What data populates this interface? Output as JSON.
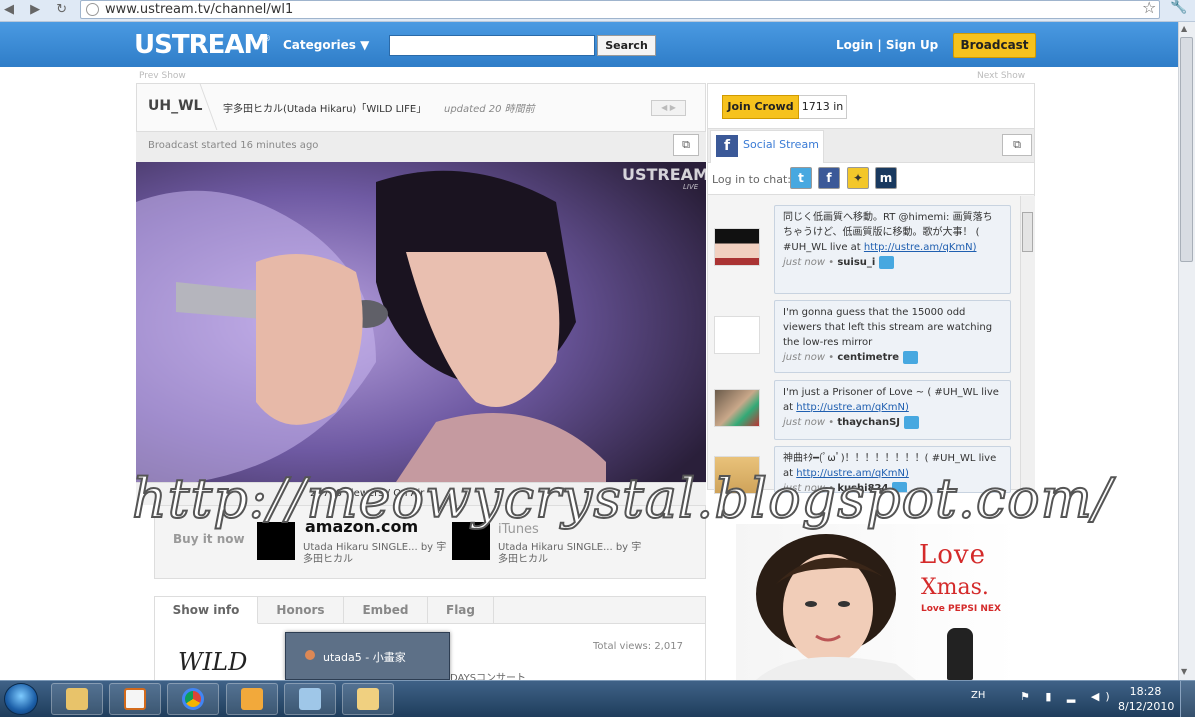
{
  "browser": {
    "url": "www.ustream.tv/channel/wl1"
  },
  "header": {
    "logo": "USTREAM",
    "registered": "®",
    "categories_label": "Categories ▼",
    "search_button": "Search",
    "login_label": "Login | Sign Up",
    "broadcast_button": "Broadcast"
  },
  "nav": {
    "prev_show": "Prev Show",
    "next_show": "Next Show"
  },
  "channel": {
    "name": "UH_WL",
    "title": "宇多田ヒカル(Utada Hikaru)「WILD LIFE」",
    "updated": "updated 20 時間前",
    "broadcast_started": "Broadcast started 16 minutes ago",
    "video_watermark": "USTREAM",
    "video_live": "LIVE",
    "viewers_text": "29716 viewers / On Air"
  },
  "buy": {
    "label": "Buy it now",
    "amazon": "amazon.com",
    "itunes": "iTunes",
    "product1": "Utada Hikaru SINGLE... by 宇多田ヒカル",
    "product2": "Utada Hikaru SINGLE... by 宇多田ヒカル"
  },
  "tabs": {
    "show_info": "Show info",
    "honors": "Honors",
    "embed": "Embed",
    "flag": "Flag"
  },
  "info": {
    "total_views": "Total views: 2,017",
    "days_text": "DAYSコンサート",
    "wild_logo": "WILD"
  },
  "taskbar_popup": {
    "label": "utada5 - 小畫家"
  },
  "crowd": {
    "join_button": "Join Crowd",
    "count": "1713 in"
  },
  "social": {
    "tab_label": "Social Stream",
    "login_to_chat": "Log in to chat:",
    "messages": [
      {
        "text": "同じく低画質へ移動。RT @himemi: 画質落ちちゃうけど、低画質版に移動。歌が大事！ ( #UH_WL live at",
        "link": "http://ustre.am/qKmN)",
        "time": "just now",
        "user": "suisu_i"
      },
      {
        "text": "I'm gonna guess that the 15000 odd viewers that left this stream are watching the low-res mirror",
        "link": "",
        "time": "just now",
        "user": "centimetre"
      },
      {
        "text": "I'm just a Prisoner of Love ~ ( #UH_WL live at",
        "link": "http://ustre.am/qKmN)",
        "time": "just now",
        "user": "thaychanSJ"
      },
      {
        "text": "神曲ｷﾀ━(ﾟωﾟ)！！！！！！！！( #UH_WL live at",
        "link": "http://ustre.am/qKmN)",
        "time": "just now",
        "user": "kushi824"
      }
    ]
  },
  "ad": {
    "love": "Love",
    "xmas": "Xmas.",
    "pepsi": "Love PEPSI NEX"
  },
  "watermark": "http://meowycrystal.blogspot.com/",
  "tray": {
    "lang": "ZH",
    "time": "18:28",
    "date": "8/12/2010"
  }
}
